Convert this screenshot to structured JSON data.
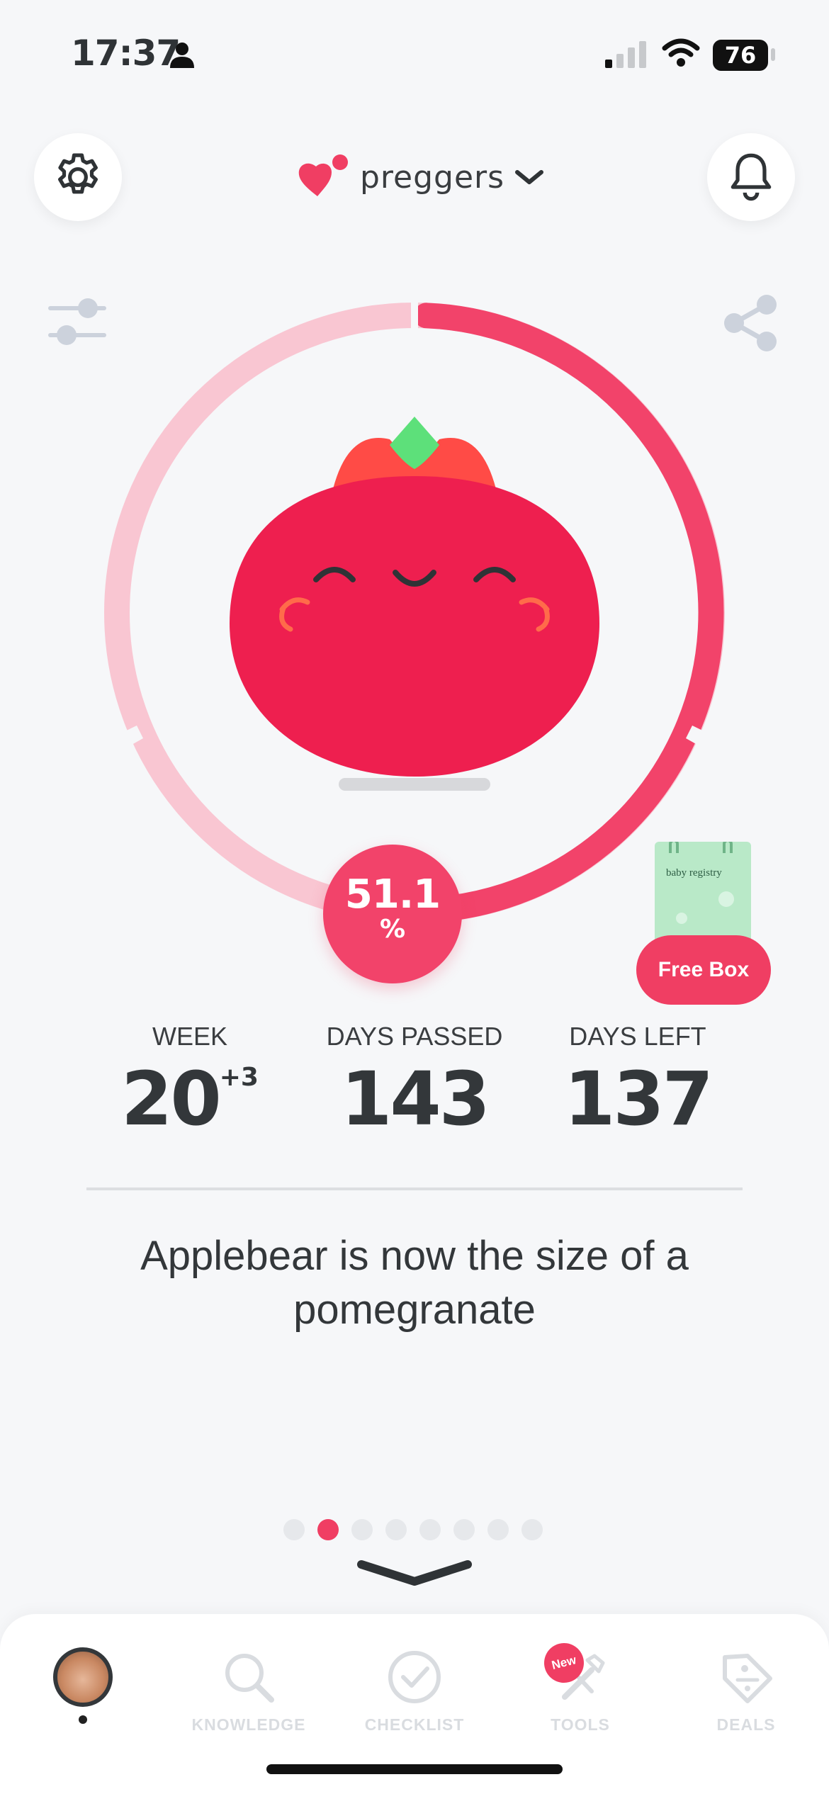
{
  "status_bar": {
    "time": "17:37",
    "battery": "76"
  },
  "header": {
    "brand": "preggers"
  },
  "progress": {
    "percent_value": "51.1",
    "percent_unit": "%",
    "fraction": 0.511
  },
  "promo": {
    "label": "Free Box",
    "box_text": "baby registry"
  },
  "stats": {
    "week": {
      "label": "WEEK",
      "value": "20",
      "extra": "+3"
    },
    "days_passed": {
      "label": "DAYS PASSED",
      "value": "143"
    },
    "days_left": {
      "label": "DAYS LEFT",
      "value": "137"
    }
  },
  "size_message": "Applebear is now the size of a pomegranate",
  "pager": {
    "count": 8,
    "active": 1
  },
  "tabs": [
    {
      "label": ""
    },
    {
      "label": "KNOWLEDGE"
    },
    {
      "label": "CHECKLIST"
    },
    {
      "label": "TOOLS",
      "badge": "New"
    },
    {
      "label": "DEALS"
    }
  ],
  "colors": {
    "accent": "#f03e63",
    "ring_light": "#f9c6d2",
    "fruit": "#ee1f4f",
    "leaf": "#5de07a"
  }
}
